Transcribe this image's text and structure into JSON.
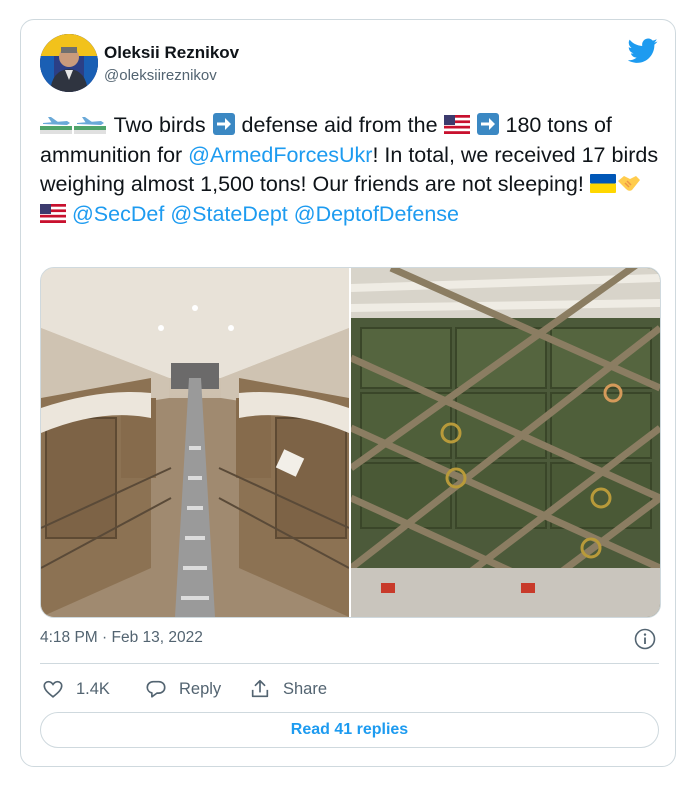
{
  "author": {
    "name": "Oleksii Reznikov",
    "handle": "@oleksiireznikov"
  },
  "tweet": {
    "seg1": " Two birds ",
    "seg2": " defense aid from the ",
    "seg3": " 180 tons of ammunition for ",
    "mention1": "@ArmedForcesUkr",
    "seg4": "! In total, we received 17 birds weighing almost 1,500 tons!  Our friends are not sleeping! ",
    "mention2": "@SecDef",
    "mention3": "@StateDept",
    "mention4": "@DeptofDefense"
  },
  "media": {
    "left": "cargo-plane-interior-photo",
    "right": "ammunition-crates-photo"
  },
  "meta": {
    "timestamp": "4:18 PM · Feb 13, 2022"
  },
  "actions": {
    "likes": "1.4K",
    "reply": "Reply",
    "share": "Share"
  },
  "read_replies": "Read 41 replies",
  "colors": {
    "accent": "#1d9bf0",
    "text": "#0f1419",
    "muted": "#536471",
    "border": "#cfd9de"
  }
}
